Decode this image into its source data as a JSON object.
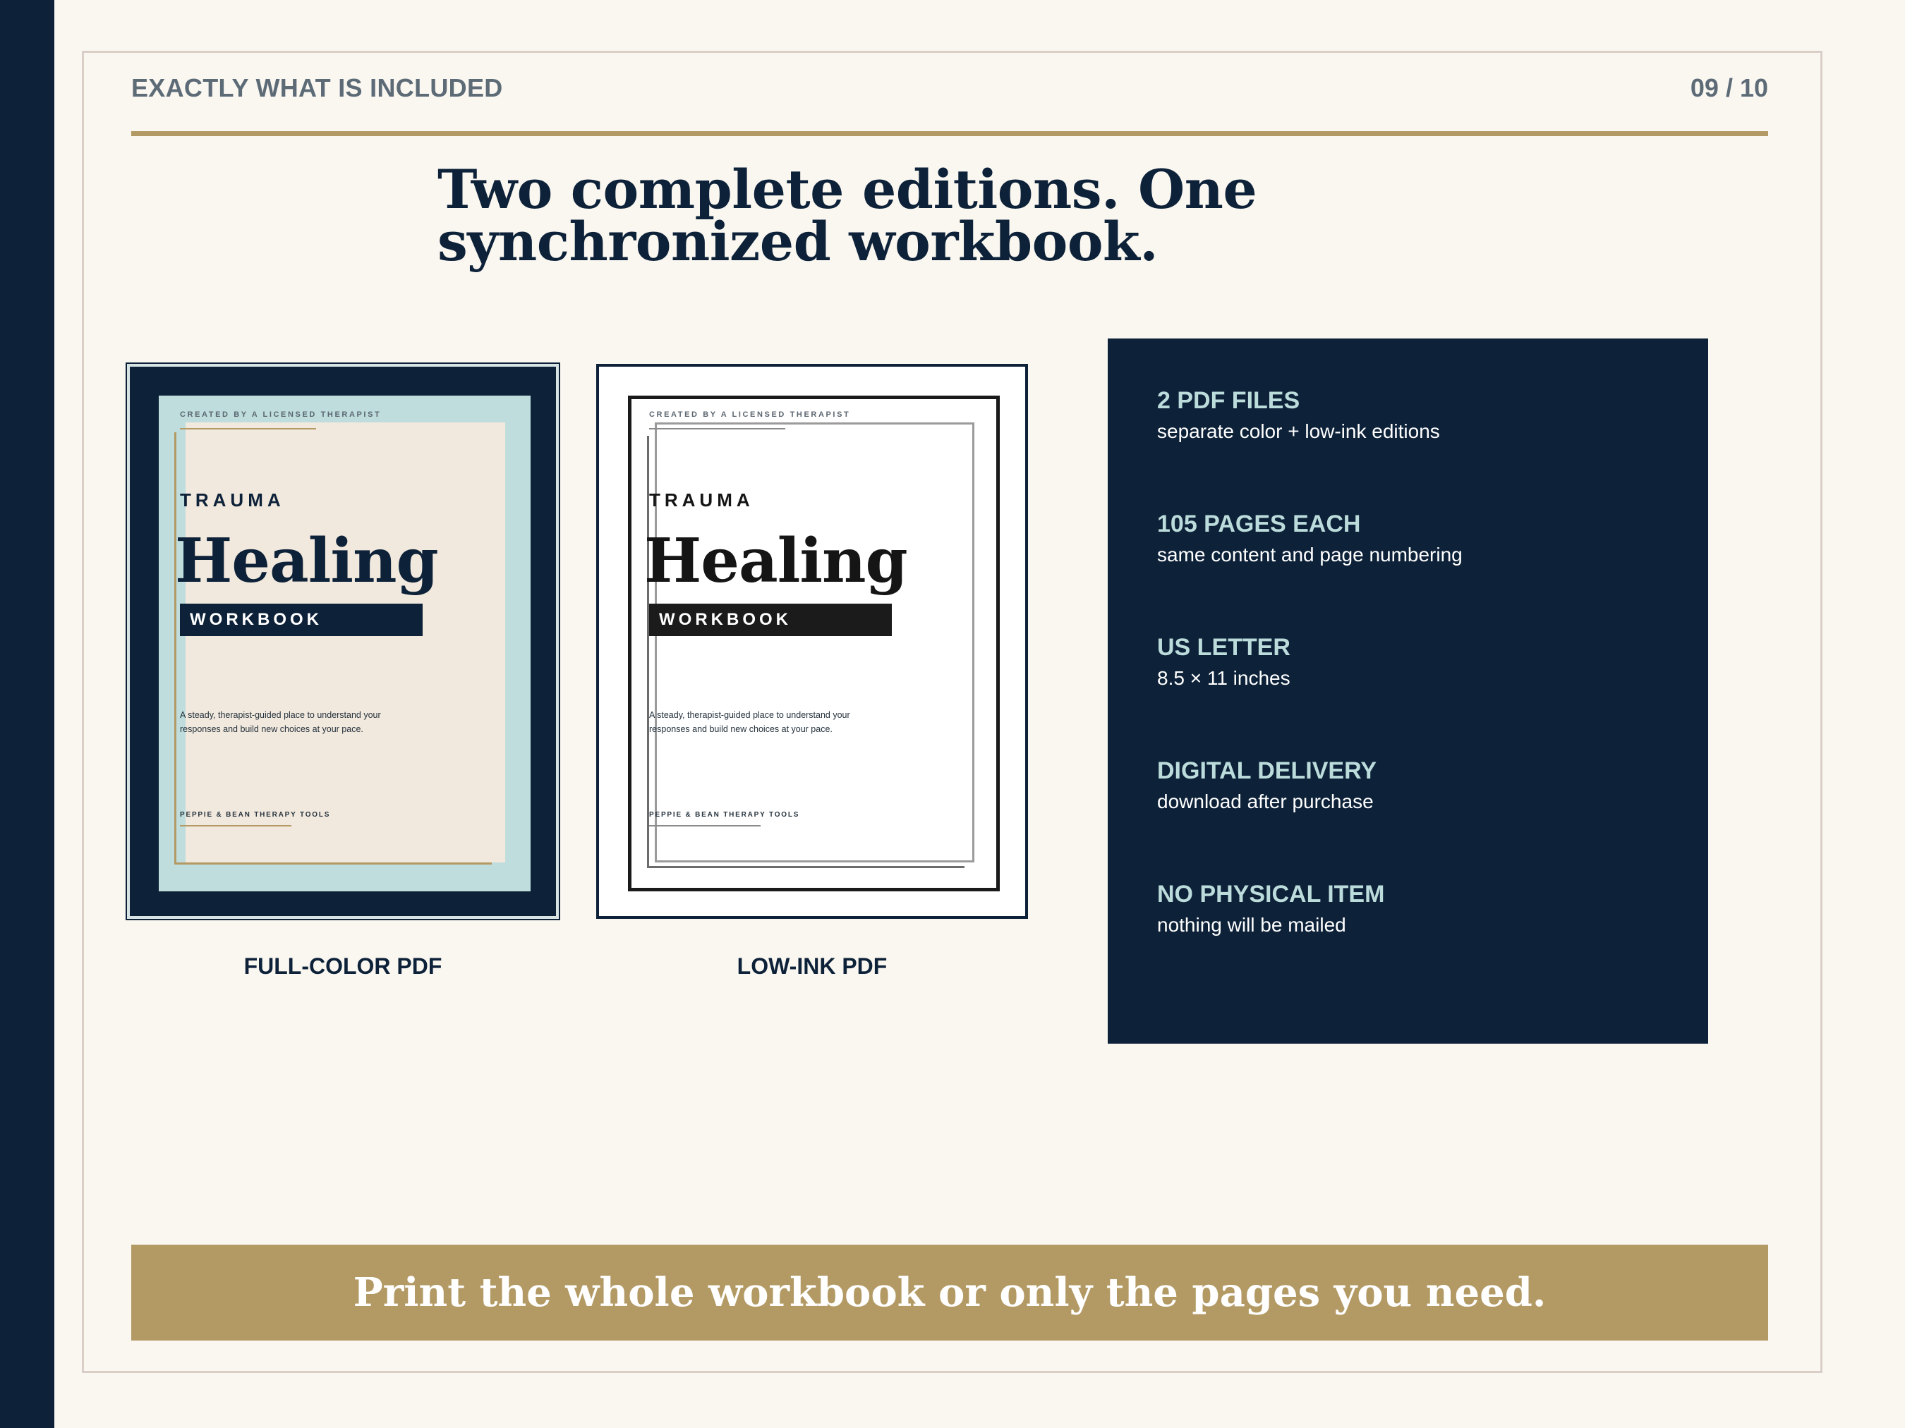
{
  "header": {
    "section_label": "EXACTLY WHAT IS INCLUDED",
    "page_number": "09 / 10"
  },
  "headline": "Two complete editions. One synchronized workbook.",
  "covers": [
    {
      "caption": "FULL-COLOR PDF",
      "kicker": "CREATED BY A LICENSED THERAPIST",
      "overline": "TRAUMA",
      "title": "Healing",
      "band": "WORKBOOK",
      "blurb": "A steady, therapist-guided place to understand your responses and build new choices at your pace.",
      "brand": "PEPPIE & BEAN THERAPY TOOLS"
    },
    {
      "caption": "LOW-INK PDF",
      "kicker": "CREATED BY A LICENSED THERAPIST",
      "overline": "TRAUMA",
      "title": "Healing",
      "band": "WORKBOOK",
      "blurb": "A steady, therapist-guided place to understand your responses and build new choices at your pace.",
      "brand": "PEPPIE & BEAN THERAPY TOOLS"
    }
  ],
  "specs": [
    {
      "title": "2 PDF FILES",
      "subtitle": "separate color + low-ink editions"
    },
    {
      "title": "105 PAGES EACH",
      "subtitle": "same content and page numbering"
    },
    {
      "title": "US LETTER",
      "subtitle": "8.5 × 11 inches"
    },
    {
      "title": "DIGITAL DELIVERY",
      "subtitle": "download after purchase"
    },
    {
      "title": "NO PHYSICAL ITEM",
      "subtitle": "nothing will be mailed"
    }
  ],
  "banner": "Print the whole workbook or only the pages you need.",
  "colors": {
    "navy": "#0d2239",
    "gold": "#b39a65",
    "mint": "#bfdddd",
    "cream": "#faf7f1",
    "paper": "#f2e9de"
  }
}
